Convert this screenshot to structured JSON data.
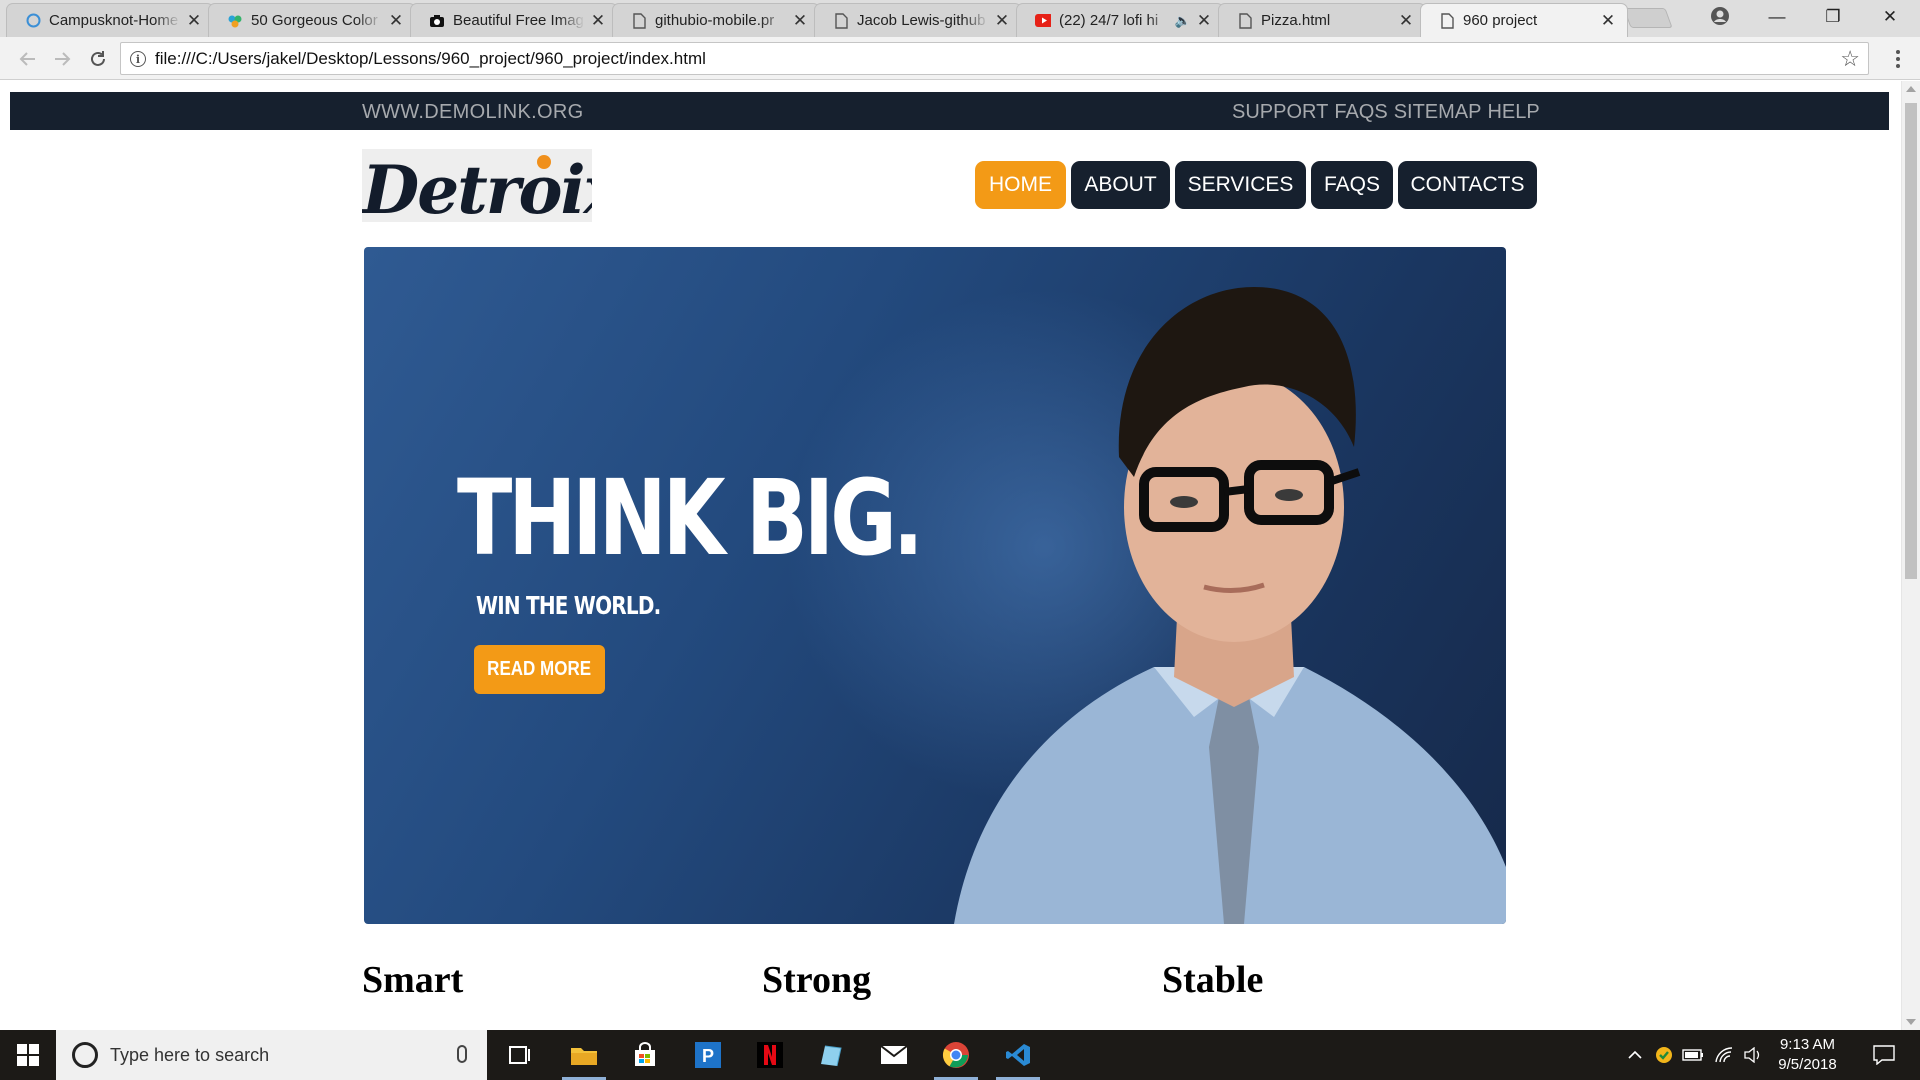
{
  "browser": {
    "tabs": [
      {
        "title": "Campusknot-Home",
        "icon": "campusknot-icon"
      },
      {
        "title": "50 Gorgeous Color",
        "icon": "color-palette-icon"
      },
      {
        "title": "Beautiful Free Imag",
        "icon": "camera-icon"
      },
      {
        "title": "githubio-mobile.pr",
        "icon": "page-icon"
      },
      {
        "title": "Jacob Lewis-github",
        "icon": "page-icon"
      },
      {
        "title": "(22) 24/7 lofi hi",
        "icon": "youtube-icon",
        "muted_indicator": "🔈"
      },
      {
        "title": "Pizza.html",
        "icon": "page-icon"
      },
      {
        "title": "960 project",
        "icon": "page-icon",
        "active": true
      }
    ],
    "close_glyph": "✕",
    "url": "file:///C:/Users/jakel/Desktop/Lessons/960_project/960_project/index.html",
    "info_glyph": "i",
    "star_glyph": "☆",
    "window_controls": {
      "minimize": "—",
      "maximize": "❐",
      "close": "✕"
    }
  },
  "page": {
    "topbar": {
      "site": "WWW.DEMOLINK.ORG",
      "links": [
        "SUPPORT",
        "FAQS",
        "SITEMAP",
        "HELP"
      ]
    },
    "logo_text": "Detroix",
    "nav": [
      {
        "label": "HOME",
        "active": true
      },
      {
        "label": "ABOUT"
      },
      {
        "label": "SERVICES"
      },
      {
        "label": "FAQS"
      },
      {
        "label": "CONTACTS"
      }
    ],
    "hero": {
      "headline": "THINK BIG.",
      "subline": "WIN THE WORLD.",
      "cta": "READ MORE"
    },
    "features": [
      "Smart",
      "Strong",
      "Stable"
    ]
  },
  "taskbar": {
    "search_placeholder": "Type here to search",
    "apps": [
      "task-view-icon",
      "file-explorer-icon",
      "store-icon",
      "p-app-icon",
      "netflix-icon",
      "notepad-icon",
      "mail-icon",
      "chrome-icon",
      "vscode-icon"
    ],
    "time": "9:13 AM",
    "date": "9/5/2018"
  },
  "colors": {
    "dark_navy": "#16202e",
    "accent_orange": "#f39a16",
    "topbar_text": "#a6a9ad"
  }
}
